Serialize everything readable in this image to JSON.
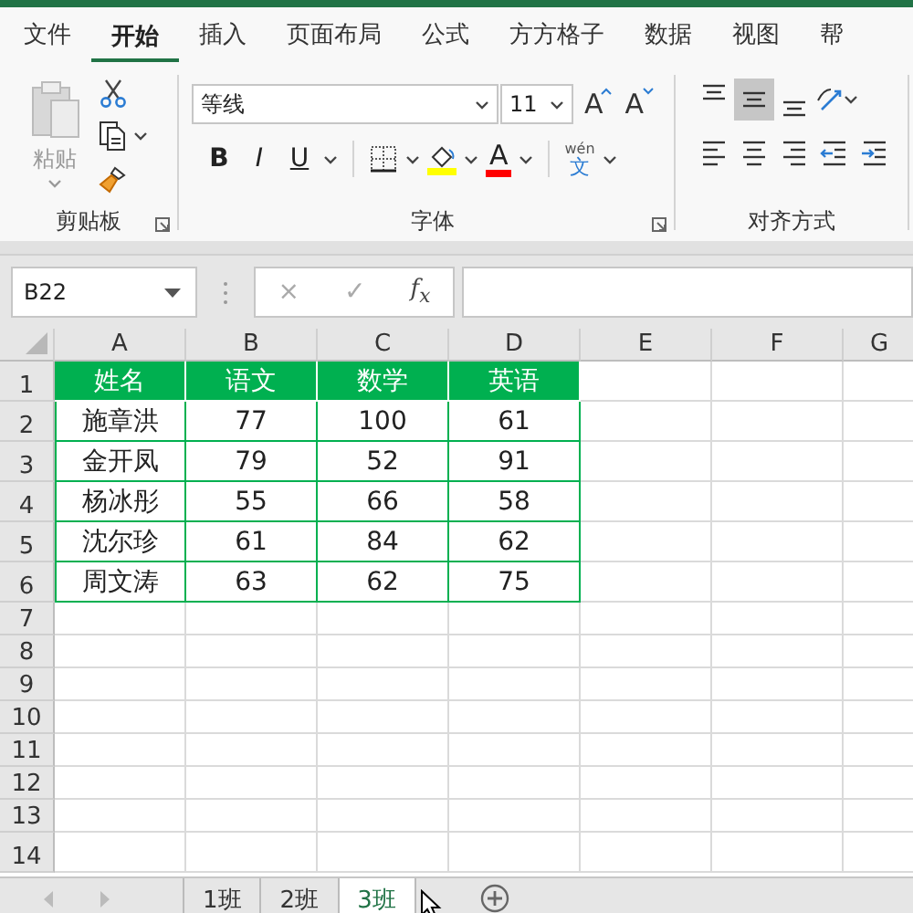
{
  "ribbon_tabs": [
    {
      "label": "文件",
      "selected": false
    },
    {
      "label": "开始",
      "selected": true
    },
    {
      "label": "插入",
      "selected": false
    },
    {
      "label": "页面布局",
      "selected": false
    },
    {
      "label": "公式",
      "selected": false
    },
    {
      "label": "方方格子",
      "selected": false
    },
    {
      "label": "数据",
      "selected": false
    },
    {
      "label": "视图",
      "selected": false
    },
    {
      "label": "帮",
      "selected": false
    }
  ],
  "clipboard": {
    "paste_label": "粘贴",
    "paste_disabled": true,
    "group_label": "剪贴板"
  },
  "font": {
    "font_name": "等线",
    "font_size": "11",
    "grow_label": "A",
    "shrink_label": "A",
    "format_buttons": [
      "B",
      "I",
      "U"
    ],
    "font_color_label": "A",
    "phonetic_top": "wén",
    "phonetic_bottom": "文",
    "group_label": "字体"
  },
  "alignment": {
    "group_label": "对齐方式",
    "buttons": [
      {
        "kind": "top",
        "on": false
      },
      {
        "kind": "middle",
        "on": true
      },
      {
        "kind": "bottom",
        "on": false
      },
      {
        "kind": "orientation",
        "on": false
      },
      {
        "kind": "left",
        "on": false
      },
      {
        "kind": "center",
        "on": false
      },
      {
        "kind": "right",
        "on": false
      },
      {
        "kind": "outdent",
        "on": false
      },
      {
        "kind": "indent",
        "on": false
      }
    ]
  },
  "formula_bar": {
    "name_box": "B22",
    "cancel": "×",
    "enter": "✓",
    "function_label": "f$_{x}$"
  },
  "sheet": {
    "columns": [
      "A",
      "B",
      "C",
      "D",
      "E",
      "F",
      "G"
    ],
    "rows": [
      {
        "number": "1",
        "kind": "header",
        "cells": [
          "姓名",
          "语文",
          "数学",
          "英语"
        ]
      },
      {
        "number": "2",
        "kind": "data",
        "cells": [
          "施章洪",
          "77",
          "100",
          "61"
        ]
      },
      {
        "number": "3",
        "kind": "data",
        "cells": [
          "金开凤",
          "79",
          "52",
          "91"
        ]
      },
      {
        "number": "4",
        "kind": "data",
        "cells": [
          "杨冰彤",
          "55",
          "66",
          "58"
        ]
      },
      {
        "number": "5",
        "kind": "data",
        "cells": [
          "沈尔珍",
          "61",
          "84",
          "62"
        ]
      },
      {
        "number": "6",
        "kind": "data",
        "cells": [
          "周文涛",
          "63",
          "62",
          "75"
        ]
      },
      {
        "number": "7",
        "kind": "empty"
      },
      {
        "number": "8",
        "kind": "empty"
      },
      {
        "number": "9",
        "kind": "empty"
      },
      {
        "number": "10",
        "kind": "empty"
      },
      {
        "number": "11",
        "kind": "empty"
      },
      {
        "number": "12",
        "kind": "empty"
      },
      {
        "number": "13",
        "kind": "empty"
      },
      {
        "number": "14",
        "kind": "empty"
      }
    ]
  },
  "sheet_tabs": [
    {
      "label": "1班",
      "selected": false
    },
    {
      "label": "2班",
      "selected": false
    },
    {
      "label": "3班",
      "selected": true
    }
  ]
}
